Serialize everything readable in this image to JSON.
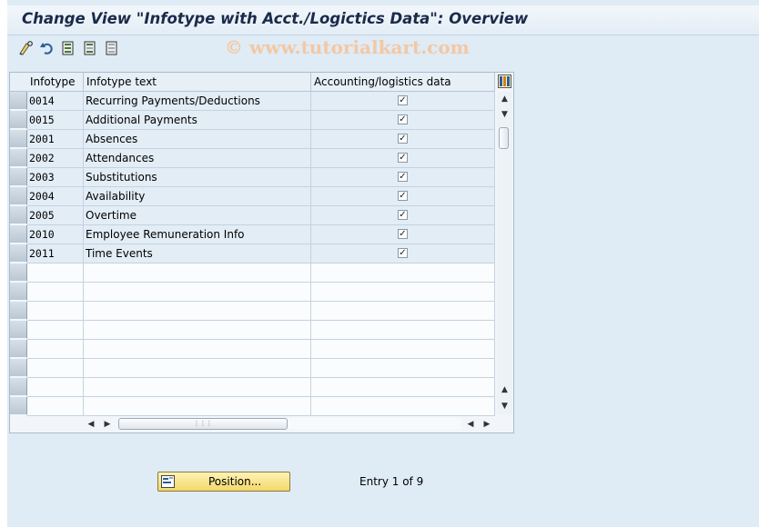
{
  "window": {
    "title": "Change View \"Infotype with Acct./Logictics Data\": Overview"
  },
  "watermark": "© www.tutorialkart.com",
  "toolbar": {
    "icons": [
      "edit-glasses-icon",
      "undo-icon",
      "select-all-icon",
      "select-block-icon",
      "deselect-all-icon"
    ]
  },
  "table": {
    "columns": [
      "Infotype",
      "Infotype text",
      "Accounting/logistics data"
    ],
    "rows": [
      {
        "infotype": "0014",
        "text": "Recurring Payments/Deductions",
        "checked": true
      },
      {
        "infotype": "0015",
        "text": "Additional Payments",
        "checked": true
      },
      {
        "infotype": "2001",
        "text": "Absences",
        "checked": true
      },
      {
        "infotype": "2002",
        "text": "Attendances",
        "checked": true
      },
      {
        "infotype": "2003",
        "text": "Substitutions",
        "checked": true
      },
      {
        "infotype": "2004",
        "text": "Availability",
        "checked": true
      },
      {
        "infotype": "2005",
        "text": "Overtime",
        "checked": true
      },
      {
        "infotype": "2010",
        "text": "Employee Remuneration Info",
        "checked": true
      },
      {
        "infotype": "2011",
        "text": "Time Events",
        "checked": true
      }
    ],
    "empty_rows": 8
  },
  "footer": {
    "position_button": "Position...",
    "entry_text": "Entry 1 of 9"
  },
  "colors": {
    "background": "#dfebf5",
    "row_fill": "#e2edf6",
    "button_fill": "#f3d86a"
  }
}
